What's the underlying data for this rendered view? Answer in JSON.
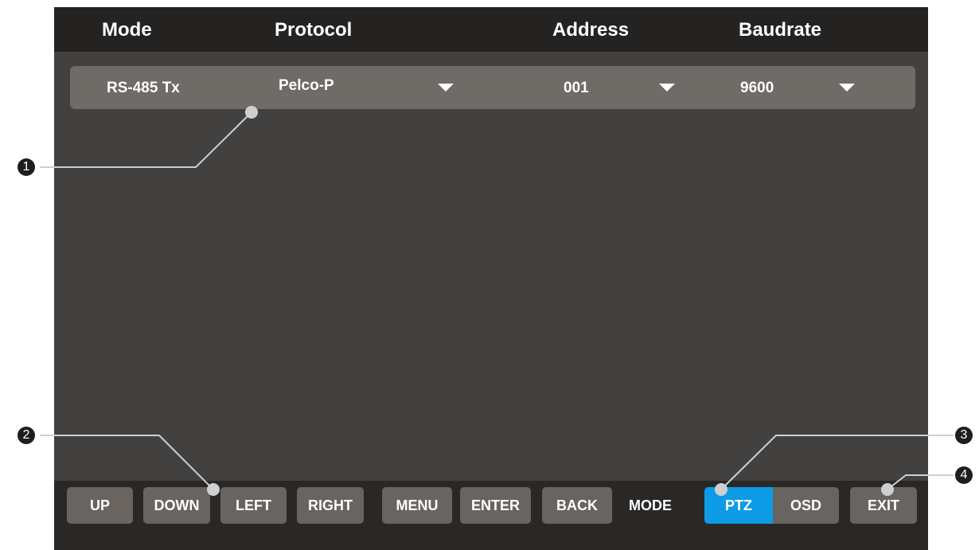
{
  "header": {
    "mode_label": "Mode",
    "protocol_label": "Protocol",
    "address_label": "Address",
    "baudrate_label": "Baudrate"
  },
  "settings_row": {
    "mode_value": "RS-485 Tx",
    "protocol_value": "Pelco-P",
    "address_value": "001",
    "baudrate_value": "9600"
  },
  "buttons": {
    "up": "UP",
    "down": "DOWN",
    "left": "LEFT",
    "right": "RIGHT",
    "menu": "MENU",
    "enter": "ENTER",
    "back": "BACK",
    "mode_label": "MODE",
    "ptz": "PTZ",
    "osd": "OSD",
    "exit": "EXIT"
  },
  "active_mode": "PTZ",
  "callouts": [
    "1",
    "2",
    "3",
    "4"
  ],
  "colors": {
    "active": "#0e9be6",
    "button": "#6a6461",
    "screen": "#434140",
    "header": "#252322"
  }
}
